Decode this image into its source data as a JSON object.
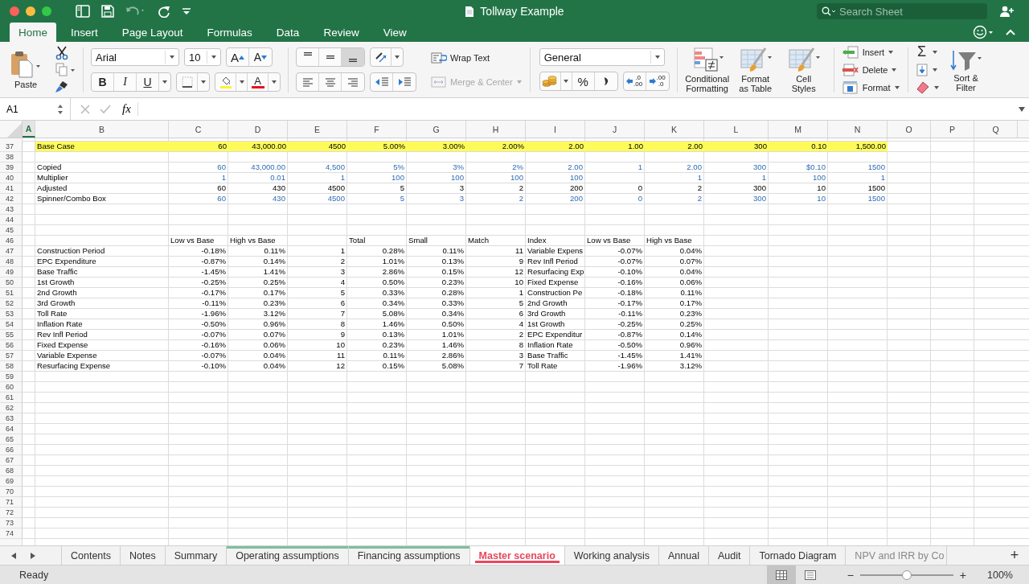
{
  "window": {
    "title": "Tollway Example"
  },
  "search": {
    "placeholder": "Search Sheet"
  },
  "ribbon_tabs": [
    {
      "label": "Home",
      "selected": true
    },
    {
      "label": "Insert",
      "selected": false
    },
    {
      "label": "Page Layout",
      "selected": false
    },
    {
      "label": "Formulas",
      "selected": false
    },
    {
      "label": "Data",
      "selected": false
    },
    {
      "label": "Review",
      "selected": false
    },
    {
      "label": "View",
      "selected": false
    }
  ],
  "clipboard": {
    "paste": "Paste"
  },
  "font": {
    "name": "Arial",
    "size": "10",
    "grow": "A",
    "shrink": "A",
    "styles": [
      "B",
      "I",
      "U"
    ],
    "color_button": "A"
  },
  "alignment": {
    "vertical": [
      {
        "selected": false
      },
      {
        "selected": false
      },
      {
        "selected": true
      }
    ]
  },
  "wrap_text": {
    "label": "Wrap Text",
    "disabled": false
  },
  "merge": {
    "label": "Merge & Center",
    "disabled": true
  },
  "number": {
    "format": "General",
    "percent": "%",
    "decimals": [
      {
        "top": ".0",
        "bottom": ".00"
      },
      {
        "top": ".00",
        "bottom": ".0"
      }
    ]
  },
  "styles": [
    "Conditional\nFormatting",
    "Format\nas Table",
    "Cell\nStyles"
  ],
  "cells_group": [
    {
      "label": "Insert",
      "kind": "insert"
    },
    {
      "label": "Delete",
      "kind": "delete"
    },
    {
      "label": "Format",
      "kind": "format"
    }
  ],
  "editing": {
    "sum": "Σ",
    "sort": "Sort &\nFilter"
  },
  "formula_bar": {
    "name_box": "A1",
    "function_label": "fx"
  },
  "columns": [
    {
      "label": "A",
      "selected": true
    },
    {
      "label": "B",
      "selected": false
    },
    {
      "label": "C",
      "selected": false
    },
    {
      "label": "D",
      "selected": false
    },
    {
      "label": "E",
      "selected": false
    },
    {
      "label": "F",
      "selected": false
    },
    {
      "label": "G",
      "selected": false
    },
    {
      "label": "H",
      "selected": false
    },
    {
      "label": "I",
      "selected": false
    },
    {
      "label": "J",
      "selected": false
    },
    {
      "label": "K",
      "selected": false
    },
    {
      "label": "L",
      "selected": false
    },
    {
      "label": "M",
      "selected": false
    },
    {
      "label": "N",
      "selected": false
    },
    {
      "label": "O",
      "selected": false
    },
    {
      "label": "P",
      "selected": false
    },
    {
      "label": "Q",
      "selected": false
    }
  ],
  "rows": [
    {
      "number": "37",
      "highlight": true,
      "input": false,
      "cells": [
        {
          "text": "Base Case",
          "kind": "text"
        },
        {
          "text": "60",
          "kind": "num"
        },
        {
          "text": "43,000.00",
          "kind": "num"
        },
        {
          "text": "4500",
          "kind": "num"
        },
        {
          "text": "5.00%",
          "kind": "num"
        },
        {
          "text": "3.00%",
          "kind": "num"
        },
        {
          "text": "2.00%",
          "kind": "num"
        },
        {
          "text": "2.00",
          "kind": "num"
        },
        {
          "text": "1.00",
          "kind": "num"
        },
        {
          "text": "2.00",
          "kind": "num"
        },
        {
          "text": "300",
          "kind": "num"
        },
        {
          "text": "0.10",
          "kind": "num"
        },
        {
          "text": "1,500.00",
          "kind": "num"
        }
      ]
    },
    {
      "number": "38"
    },
    {
      "number": "39",
      "highlight": false,
      "input": true,
      "cells": [
        {
          "text": "Copied",
          "kind": "text"
        },
        {
          "text": "60",
          "kind": "num"
        },
        {
          "text": "43,000.00",
          "kind": "num"
        },
        {
          "text": "4,500",
          "kind": "num"
        },
        {
          "text": "5%",
          "kind": "num"
        },
        {
          "text": "3%",
          "kind": "num"
        },
        {
          "text": "2%",
          "kind": "num"
        },
        {
          "text": "2.00",
          "kind": "num"
        },
        {
          "text": "1",
          "kind": "num"
        },
        {
          "text": "2.00",
          "kind": "num"
        },
        {
          "text": "300",
          "kind": "num"
        },
        {
          "text": "$0.10",
          "kind": "num"
        },
        {
          "text": "1500",
          "kind": "num"
        }
      ]
    },
    {
      "number": "40",
      "highlight": false,
      "input": true,
      "cells": [
        {
          "text": "Multiplier",
          "kind": "text"
        },
        {
          "text": "1",
          "kind": "num"
        },
        {
          "text": "0.01",
          "kind": "num"
        },
        {
          "text": "1",
          "kind": "num"
        },
        {
          "text": "100",
          "kind": "num"
        },
        {
          "text": "100",
          "kind": "num"
        },
        {
          "text": "100",
          "kind": "num"
        },
        {
          "text": "100",
          "kind": "num"
        },
        {
          "kind": "empty"
        },
        {
          "text": "1",
          "kind": "num"
        },
        {
          "text": "1",
          "kind": "num"
        },
        {
          "text": "100",
          "kind": "num"
        },
        {
          "text": "1",
          "kind": "num"
        }
      ]
    },
    {
      "number": "41",
      "highlight": false,
      "input": false,
      "cells": [
        {
          "text": "Adjusted",
          "kind": "text"
        },
        {
          "text": "60",
          "kind": "num"
        },
        {
          "text": "430",
          "kind": "num"
        },
        {
          "text": "4500",
          "kind": "num"
        },
        {
          "text": "5",
          "kind": "num"
        },
        {
          "text": "3",
          "kind": "num"
        },
        {
          "text": "2",
          "kind": "num"
        },
        {
          "text": "200",
          "kind": "num"
        },
        {
          "text": "0",
          "kind": "num"
        },
        {
          "text": "2",
          "kind": "num"
        },
        {
          "text": "300",
          "kind": "num"
        },
        {
          "text": "10",
          "kind": "num"
        },
        {
          "text": "1500",
          "kind": "num"
        }
      ]
    },
    {
      "number": "42",
      "highlight": false,
      "input": true,
      "cells": [
        {
          "text": "Spinner/Combo Box",
          "kind": "text"
        },
        {
          "text": "60",
          "kind": "num"
        },
        {
          "text": "430",
          "kind": "num"
        },
        {
          "text": "4500",
          "kind": "num"
        },
        {
          "text": "5",
          "kind": "num"
        },
        {
          "text": "3",
          "kind": "num"
        },
        {
          "text": "2",
          "kind": "num"
        },
        {
          "text": "200",
          "kind": "num"
        },
        {
          "text": "0",
          "kind": "num"
        },
        {
          "text": "2",
          "kind": "num"
        },
        {
          "text": "300",
          "kind": "num"
        },
        {
          "text": "10",
          "kind": "num"
        },
        {
          "text": "1500",
          "kind": "num"
        }
      ]
    },
    {
      "number": "43"
    },
    {
      "number": "44"
    },
    {
      "number": "45"
    },
    {
      "number": "46",
      "cells": [
        {
          "kind": "empty"
        },
        {
          "text": "Low vs Base",
          "kind": "text"
        },
        {
          "text": "High vs Base",
          "kind": "text"
        },
        {
          "kind": "empty"
        },
        {
          "text": "Total",
          "kind": "text"
        },
        {
          "text": "Small",
          "kind": "text"
        },
        {
          "text": "Match",
          "kind": "text"
        },
        {
          "text": "Index",
          "kind": "text"
        },
        {
          "text": "Low vs Base",
          "kind": "text"
        },
        {
          "text": "High vs Base",
          "kind": "text"
        }
      ]
    },
    {
      "number": "47",
      "cells": [
        {
          "text": "Construction Period",
          "kind": "text"
        },
        {
          "text": "-0.18%",
          "kind": "num"
        },
        {
          "text": "0.11%",
          "kind": "num"
        },
        {
          "text": "1",
          "kind": "num"
        },
        {
          "text": "0.28%",
          "kind": "num"
        },
        {
          "text": "0.11%",
          "kind": "num"
        },
        {
          "text": "11",
          "kind": "num"
        },
        {
          "text": "Variable Expens",
          "kind": "text"
        },
        {
          "text": "-0.07%",
          "kind": "num"
        },
        {
          "text": "0.04%",
          "kind": "num"
        }
      ]
    },
    {
      "number": "48",
      "cells": [
        {
          "text": "EPC Expenditure",
          "kind": "text"
        },
        {
          "text": "-0.87%",
          "kind": "num"
        },
        {
          "text": "0.14%",
          "kind": "num"
        },
        {
          "text": "2",
          "kind": "num"
        },
        {
          "text": "1.01%",
          "kind": "num"
        },
        {
          "text": "0.13%",
          "kind": "num"
        },
        {
          "text": "9",
          "kind": "num"
        },
        {
          "text": "Rev Infl Period",
          "kind": "text"
        },
        {
          "text": "-0.07%",
          "kind": "num"
        },
        {
          "text": "0.07%",
          "kind": "num"
        }
      ]
    },
    {
      "number": "49",
      "cells": [
        {
          "text": "Base Traffic",
          "kind": "text"
        },
        {
          "text": "-1.45%",
          "kind": "num"
        },
        {
          "text": "1.41%",
          "kind": "num"
        },
        {
          "text": "3",
          "kind": "num"
        },
        {
          "text": "2.86%",
          "kind": "num"
        },
        {
          "text": "0.15%",
          "kind": "num"
        },
        {
          "text": "12",
          "kind": "num"
        },
        {
          "text": "Resurfacing Exp",
          "kind": "text"
        },
        {
          "text": "-0.10%",
          "kind": "num"
        },
        {
          "text": "0.04%",
          "kind": "num"
        }
      ]
    },
    {
      "number": "50",
      "cells": [
        {
          "text": "1st Growth",
          "kind": "text"
        },
        {
          "text": "-0.25%",
          "kind": "num"
        },
        {
          "text": "0.25%",
          "kind": "num"
        },
        {
          "text": "4",
          "kind": "num"
        },
        {
          "text": "0.50%",
          "kind": "num"
        },
        {
          "text": "0.23%",
          "kind": "num"
        },
        {
          "text": "10",
          "kind": "num"
        },
        {
          "text": "Fixed Expense",
          "kind": "text"
        },
        {
          "text": "-0.16%",
          "kind": "num"
        },
        {
          "text": "0.06%",
          "kind": "num"
        }
      ]
    },
    {
      "number": "51",
      "cells": [
        {
          "text": "2nd Growth",
          "kind": "text"
        },
        {
          "text": "-0.17%",
          "kind": "num"
        },
        {
          "text": "0.17%",
          "kind": "num"
        },
        {
          "text": "5",
          "kind": "num"
        },
        {
          "text": "0.33%",
          "kind": "num"
        },
        {
          "text": "0.28%",
          "kind": "num"
        },
        {
          "text": "1",
          "kind": "num"
        },
        {
          "text": "Construction Pe",
          "kind": "text"
        },
        {
          "text": "-0.18%",
          "kind": "num"
        },
        {
          "text": "0.11%",
          "kind": "num"
        }
      ]
    },
    {
      "number": "52",
      "cells": [
        {
          "text": "3rd Growth",
          "kind": "text"
        },
        {
          "text": "-0.11%",
          "kind": "num"
        },
        {
          "text": "0.23%",
          "kind": "num"
        },
        {
          "text": "6",
          "kind": "num"
        },
        {
          "text": "0.34%",
          "kind": "num"
        },
        {
          "text": "0.33%",
          "kind": "num"
        },
        {
          "text": "5",
          "kind": "num"
        },
        {
          "text": "2nd Growth",
          "kind": "text"
        },
        {
          "text": "-0.17%",
          "kind": "num"
        },
        {
          "text": "0.17%",
          "kind": "num"
        }
      ]
    },
    {
      "number": "53",
      "cells": [
        {
          "text": "Toll Rate",
          "kind": "text"
        },
        {
          "text": "-1.96%",
          "kind": "num"
        },
        {
          "text": "3.12%",
          "kind": "num"
        },
        {
          "text": "7",
          "kind": "num"
        },
        {
          "text": "5.08%",
          "kind": "num"
        },
        {
          "text": "0.34%",
          "kind": "num"
        },
        {
          "text": "6",
          "kind": "num"
        },
        {
          "text": "3rd Growth",
          "kind": "text"
        },
        {
          "text": "-0.11%",
          "kind": "num"
        },
        {
          "text": "0.23%",
          "kind": "num"
        }
      ]
    },
    {
      "number": "54",
      "cells": [
        {
          "text": "Inflation Rate",
          "kind": "text"
        },
        {
          "text": "-0.50%",
          "kind": "num"
        },
        {
          "text": "0.96%",
          "kind": "num"
        },
        {
          "text": "8",
          "kind": "num"
        },
        {
          "text": "1.46%",
          "kind": "num"
        },
        {
          "text": "0.50%",
          "kind": "num"
        },
        {
          "text": "4",
          "kind": "num"
        },
        {
          "text": "1st Growth",
          "kind": "text"
        },
        {
          "text": "-0.25%",
          "kind": "num"
        },
        {
          "text": "0.25%",
          "kind": "num"
        }
      ]
    },
    {
      "number": "55",
      "cells": [
        {
          "text": "Rev Infl Period",
          "kind": "text"
        },
        {
          "text": "-0.07%",
          "kind": "num"
        },
        {
          "text": "0.07%",
          "kind": "num"
        },
        {
          "text": "9",
          "kind": "num"
        },
        {
          "text": "0.13%",
          "kind": "num"
        },
        {
          "text": "1.01%",
          "kind": "num"
        },
        {
          "text": "2",
          "kind": "num"
        },
        {
          "text": "EPC Expenditur",
          "kind": "text"
        },
        {
          "text": "-0.87%",
          "kind": "num"
        },
        {
          "text": "0.14%",
          "kind": "num"
        }
      ]
    },
    {
      "number": "56",
      "cells": [
        {
          "text": "Fixed Expense",
          "kind": "text"
        },
        {
          "text": "-0.16%",
          "kind": "num"
        },
        {
          "text": "0.06%",
          "kind": "num"
        },
        {
          "text": "10",
          "kind": "num"
        },
        {
          "text": "0.23%",
          "kind": "num"
        },
        {
          "text": "1.46%",
          "kind": "num"
        },
        {
          "text": "8",
          "kind": "num"
        },
        {
          "text": "Inflation Rate",
          "kind": "text"
        },
        {
          "text": "-0.50%",
          "kind": "num"
        },
        {
          "text": "0.96%",
          "kind": "num"
        }
      ]
    },
    {
      "number": "57",
      "cells": [
        {
          "text": "Variable Expense",
          "kind": "text"
        },
        {
          "text": "-0.07%",
          "kind": "num"
        },
        {
          "text": "0.04%",
          "kind": "num"
        },
        {
          "text": "11",
          "kind": "num"
        },
        {
          "text": "0.11%",
          "kind": "num"
        },
        {
          "text": "2.86%",
          "kind": "num"
        },
        {
          "text": "3",
          "kind": "num"
        },
        {
          "text": "Base Traffic",
          "kind": "text"
        },
        {
          "text": "-1.45%",
          "kind": "num"
        },
        {
          "text": "1.41%",
          "kind": "num"
        }
      ]
    },
    {
      "number": "58",
      "cells": [
        {
          "text": "Resurfacing Expense",
          "kind": "text"
        },
        {
          "text": "-0.10%",
          "kind": "num"
        },
        {
          "text": "0.04%",
          "kind": "num"
        },
        {
          "text": "12",
          "kind": "num"
        },
        {
          "text": "0.15%",
          "kind": "num"
        },
        {
          "text": "5.08%",
          "kind": "num"
        },
        {
          "text": "7",
          "kind": "num"
        },
        {
          "text": "Toll Rate",
          "kind": "text"
        },
        {
          "text": "-1.96%",
          "kind": "num"
        },
        {
          "text": "3.12%",
          "kind": "num"
        }
      ]
    },
    {
      "number": "59"
    },
    {
      "number": "60"
    },
    {
      "number": "61"
    },
    {
      "number": "62"
    },
    {
      "number": "63"
    },
    {
      "number": "64"
    },
    {
      "number": "65"
    },
    {
      "number": "66"
    },
    {
      "number": "67"
    },
    {
      "number": "68"
    },
    {
      "number": "69"
    },
    {
      "number": "70"
    },
    {
      "number": "71"
    },
    {
      "number": "72"
    },
    {
      "number": "73"
    },
    {
      "number": "74"
    }
  ],
  "sheets": [
    {
      "label": "Contents",
      "selected": false
    },
    {
      "label": "Notes",
      "selected": false
    },
    {
      "label": "Summary",
      "selected": false
    },
    {
      "label": "Operating assumptions",
      "selected": false,
      "color": "#7dbfa3"
    },
    {
      "label": "Financing assumptions",
      "selected": false,
      "color": "#7dbfa3"
    },
    {
      "label": "Master scenario",
      "selected": true,
      "color": "#e8485c"
    },
    {
      "label": "Working analysis",
      "selected": false
    },
    {
      "label": "Annual",
      "selected": false
    },
    {
      "label": "Audit",
      "selected": false
    },
    {
      "label": "Tornado Diagram",
      "selected": false
    },
    {
      "label": "NPV and IRR by Co",
      "selected": false,
      "cut": true
    }
  ],
  "add_sheet": "+",
  "status_bar": {
    "status": "Ready",
    "views": [
      {
        "selected": true
      },
      {
        "selected": false
      }
    ],
    "zoom_out": "−",
    "zoom_in": "+",
    "zoom": {
      "level": 0.5,
      "reading": "100%"
    }
  }
}
